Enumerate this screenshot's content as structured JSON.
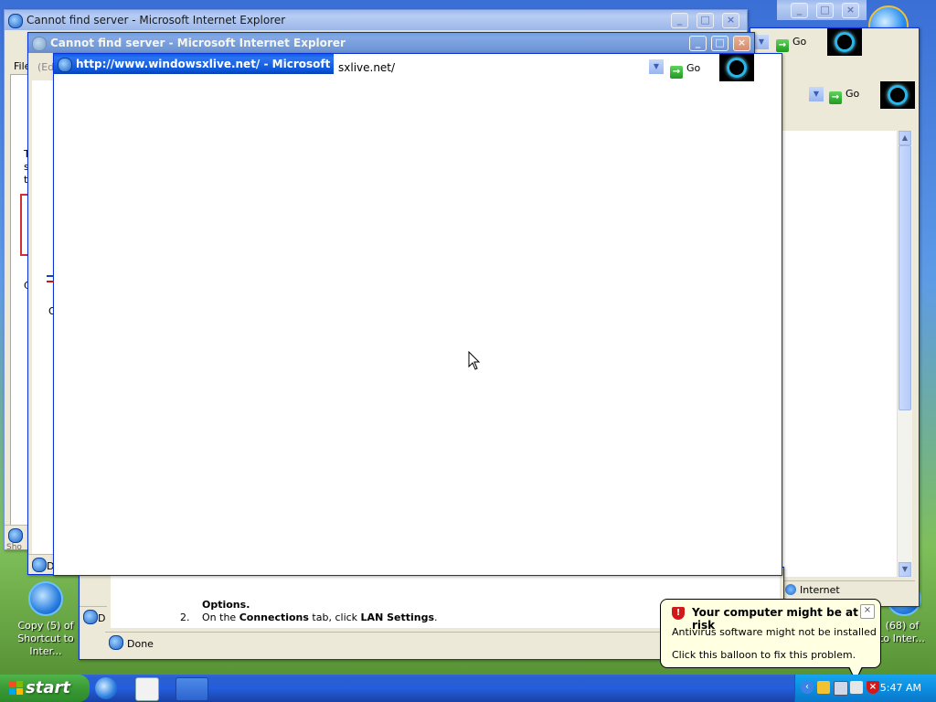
{
  "desktop": {
    "icons": [
      {
        "line1": "Copy (5) of",
        "line2": "Shortcut to Inter..."
      },
      {
        "line1": "(68) of",
        "line2": "to Inter..."
      }
    ],
    "partial_label_left": "Sho"
  },
  "windows": {
    "back": {
      "title": "Cannot find server - Microsoft Internet Explorer",
      "go_label": "Go",
      "status_right": "Internet",
      "menu_frag": "File",
      "addr_frag": "(Ed",
      "fragments": [
        "T",
        "s",
        "t",
        "C",
        "O"
      ]
    },
    "middle": {
      "title": "Cannot find server - Microsoft Internet Explorer",
      "go_label": "Go"
    },
    "front": {
      "title": "http://www.windowsxlive.net/ - Microsoft Int",
      "address": "sxlive.net/",
      "go_label": "Go"
    },
    "bottom": {
      "go_label": "Go",
      "status": "Done",
      "step_heading": "Options.",
      "step2_num": "2.",
      "step2_a": "On the ",
      "step2_b": "Connections",
      "step2_c": " tab, click ",
      "step2_d": "LAN Settings",
      "step2_e": ".",
      "taskbtn_label": "D"
    },
    "stub_labels": [
      "D",
      "D",
      "D"
    ]
  },
  "balloon": {
    "title": "Your computer might be at risk",
    "line1": "Antivirus software might not be installed",
    "line2": "Click this balloon to fix this problem."
  },
  "taskbar": {
    "start_label": "start",
    "clock": "5:47 AM"
  },
  "colors": {
    "xp_blue": "#0a5fe8",
    "taskbar": "#245edb",
    "start_green": "#3a9a35",
    "balloon_bg": "#ffffe1",
    "alert_red": "#d21818"
  }
}
